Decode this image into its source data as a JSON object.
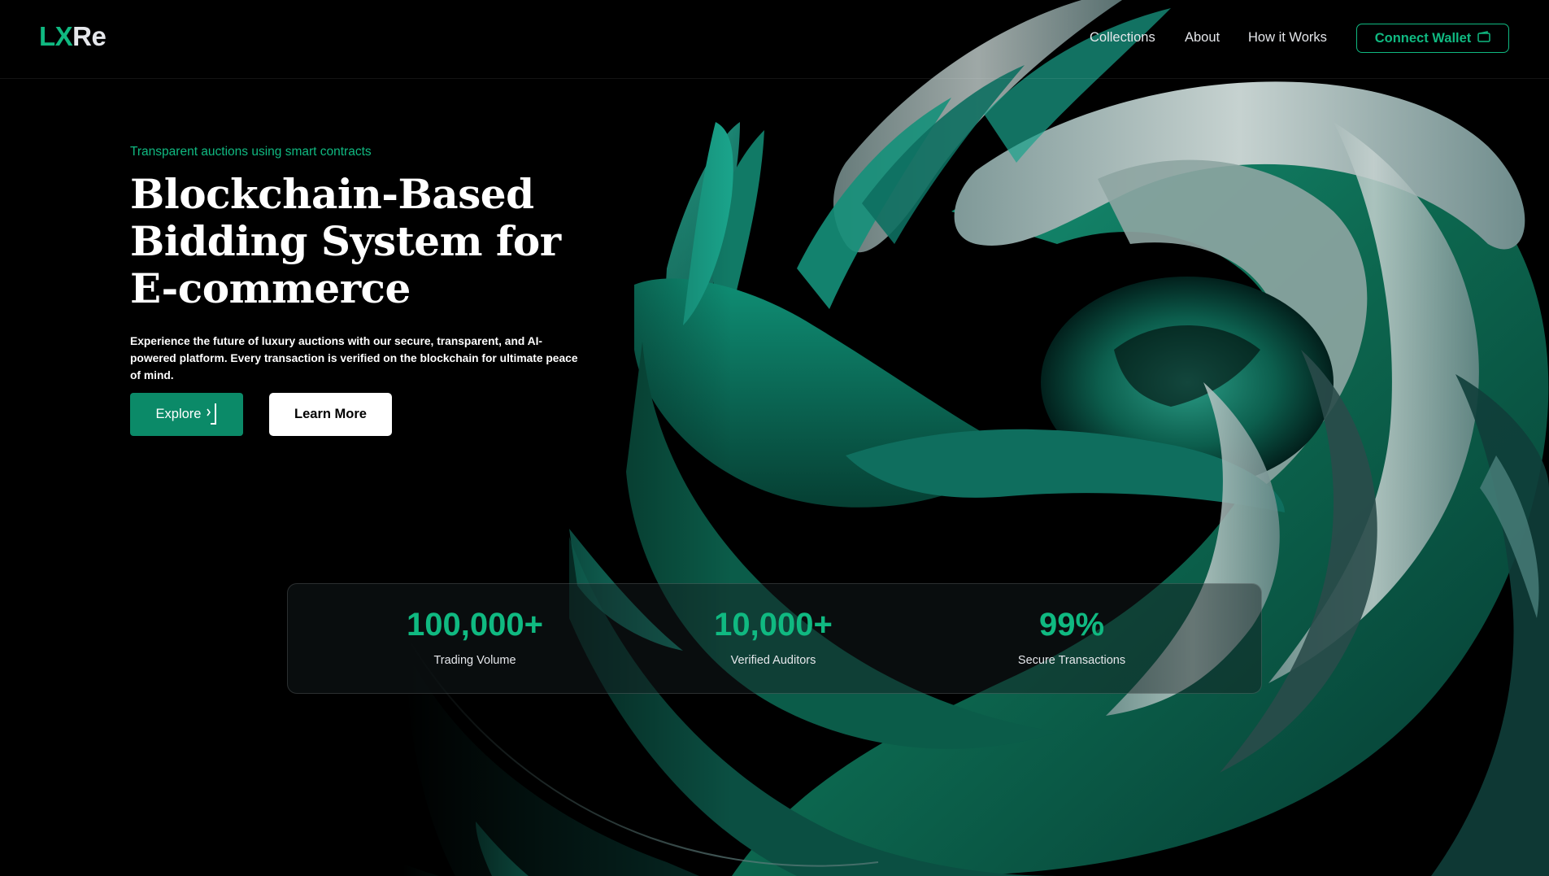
{
  "brand": {
    "logo_green": "LX",
    "logo_white": "Re",
    "accent": "#10b981"
  },
  "nav": {
    "items": [
      {
        "label": "Collections"
      },
      {
        "label": "About"
      },
      {
        "label": "How it Works"
      }
    ],
    "connect_label": "Connect Wallet",
    "connect_icon": "wallet-icon"
  },
  "hero": {
    "eyebrow": "Transparent auctions using smart contracts",
    "title_lines": [
      "Blockchain-Based",
      "Bidding System for",
      "E-commerce"
    ],
    "description": "Experience the future of luxury auctions with our secure, transparent, and AI-powered platform. Every transaction is verified on the blockchain for ultimate peace of mind.",
    "explore_label": "Explore",
    "explore_icon": "chevron-right-icon",
    "learn_more_label": "Learn More"
  },
  "stats": [
    {
      "value": "100,000+",
      "label": "Trading Volume"
    },
    {
      "value": "10,000+",
      "label": "Verified Auditors"
    },
    {
      "value": "99%",
      "label": "Secure Transactions"
    }
  ]
}
